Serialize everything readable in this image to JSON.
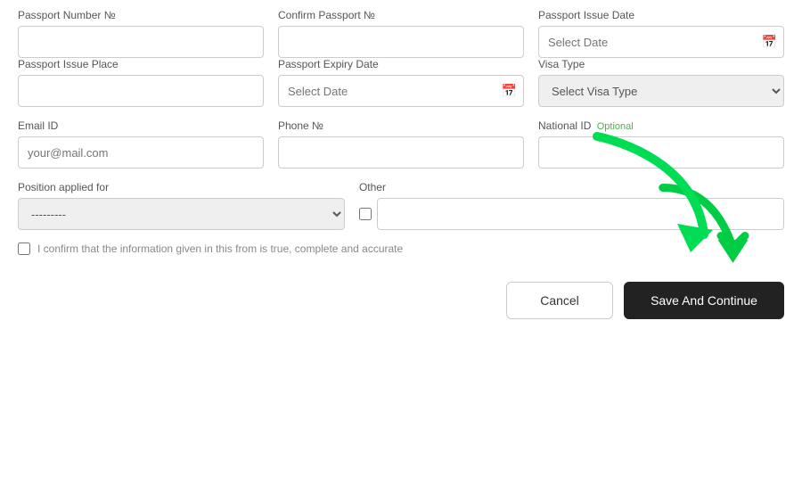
{
  "form": {
    "row1": {
      "passport_number": {
        "label": "Passport Number №",
        "placeholder": ""
      },
      "confirm_passport": {
        "label": "Confirm Passport №",
        "placeholder": ""
      },
      "passport_issue_date": {
        "label": "Passport Issue Date",
        "placeholder": "Select Date"
      }
    },
    "row2": {
      "passport_issue_place": {
        "label": "Passport Issue Place",
        "placeholder": ""
      },
      "passport_expiry_date": {
        "label": "Passport Expiry Date",
        "placeholder": "Select Date"
      },
      "visa_type": {
        "label": "Visa Type",
        "placeholder": "Select Visa Type",
        "options": [
          "Select Visa Type"
        ]
      }
    },
    "row3": {
      "email_id": {
        "label": "Email ID",
        "placeholder": "your@mail.com"
      },
      "phone": {
        "label": "Phone №",
        "placeholder": ""
      },
      "national_id": {
        "label": "National ID",
        "optional_label": "Optional",
        "placeholder": ""
      }
    },
    "row4": {
      "position_applied_for": {
        "label": "Position applied for",
        "placeholder": "---------",
        "options": [
          "---------"
        ]
      },
      "other": {
        "label": "Other",
        "placeholder": ""
      }
    },
    "confirm_text": "I confirm that the information given in this from is true, complete and accurate"
  },
  "buttons": {
    "cancel_label": "Cancel",
    "save_label": "Save And Continue"
  }
}
